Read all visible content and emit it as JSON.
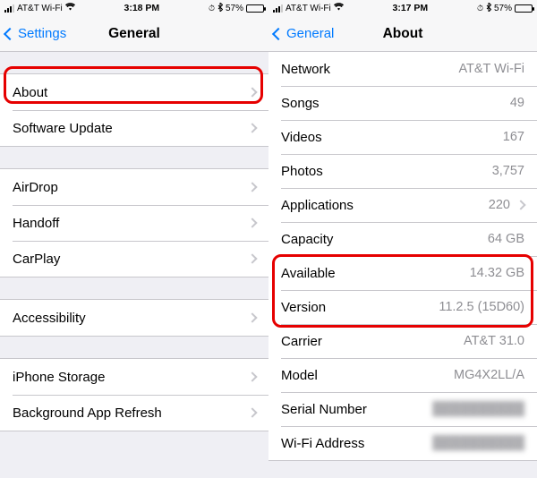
{
  "left": {
    "status": {
      "carrier": "AT&T Wi-Fi",
      "time": "3:18 PM",
      "battery_pct": "57%"
    },
    "nav": {
      "back": "Settings",
      "title": "General"
    },
    "groups": [
      [
        {
          "label": "About",
          "disclosure": true
        },
        {
          "label": "Software Update",
          "disclosure": true
        }
      ],
      [
        {
          "label": "AirDrop",
          "disclosure": true
        },
        {
          "label": "Handoff",
          "disclosure": true
        },
        {
          "label": "CarPlay",
          "disclosure": true
        }
      ],
      [
        {
          "label": "Accessibility",
          "disclosure": true
        }
      ],
      [
        {
          "label": "iPhone Storage",
          "disclosure": true
        },
        {
          "label": "Background App Refresh",
          "disclosure": true
        }
      ]
    ]
  },
  "right": {
    "status": {
      "carrier": "AT&T Wi-Fi",
      "time": "3:17 PM",
      "battery_pct": "57%"
    },
    "nav": {
      "back": "General",
      "title": "About"
    },
    "rows": [
      {
        "label": "Network",
        "value": "AT&T Wi-Fi"
      },
      {
        "label": "Songs",
        "value": "49"
      },
      {
        "label": "Videos",
        "value": "167"
      },
      {
        "label": "Photos",
        "value": "3,757"
      },
      {
        "label": "Applications",
        "value": "220",
        "disclosure": true
      },
      {
        "label": "Capacity",
        "value": "64 GB"
      },
      {
        "label": "Available",
        "value": "14.32 GB"
      },
      {
        "label": "Version",
        "value": "11.2.5 (15D60)"
      },
      {
        "label": "Carrier",
        "value": "AT&T 31.0"
      },
      {
        "label": "Model",
        "value": "MG4X2LL/A"
      },
      {
        "label": "Serial Number",
        "value": "",
        "blurvalue": true
      },
      {
        "label": "Wi-Fi Address",
        "value": "",
        "blurvalue": true
      }
    ]
  },
  "icons": {
    "bluetooth": "✱",
    "alarm": "⏰"
  }
}
